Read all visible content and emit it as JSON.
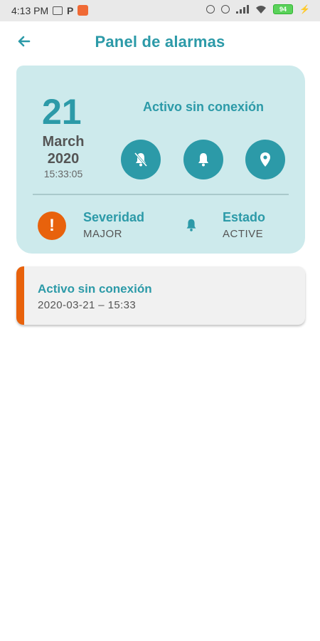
{
  "status_bar": {
    "time": "4:13 PM",
    "battery": "94"
  },
  "header": {
    "title": "Panel de alarmas",
    "back_icon": "arrow-left-icon"
  },
  "alarm": {
    "day": "21",
    "month": "March",
    "year": "2020",
    "time": "15:33:05",
    "name": "Activo sin conexión",
    "actions": [
      "bell-off-icon",
      "bell-icon",
      "location-pin-icon"
    ],
    "severity_label": "Severidad",
    "severity_value": "MAJOR",
    "state_label": "Estado",
    "state_value": "ACTIVE"
  },
  "list": [
    {
      "title": "Activo sin conexión",
      "subtitle": "2020-03-21 – 15:33"
    }
  ],
  "colors": {
    "primary": "#2c9aa8",
    "accent": "#e8620c",
    "card": "#cdeaec"
  }
}
